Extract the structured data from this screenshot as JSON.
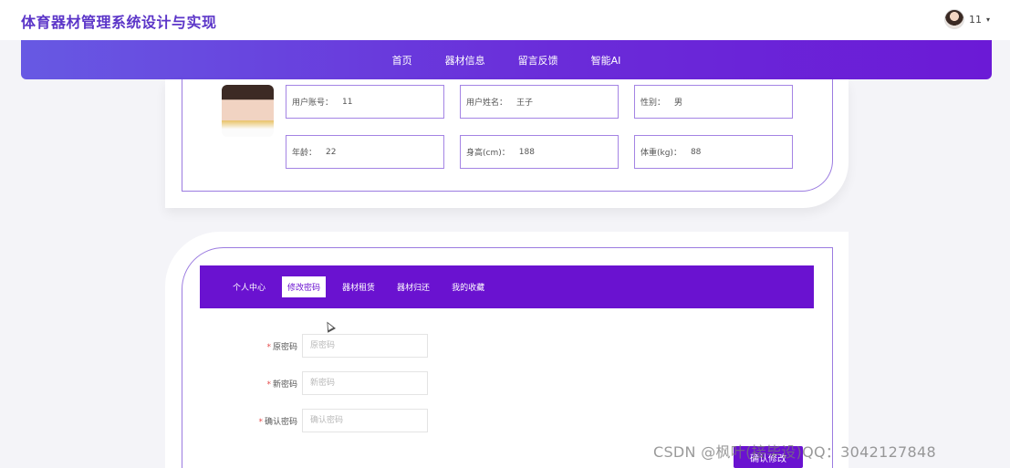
{
  "app": {
    "title": "体育器材管理系统设计与实现"
  },
  "user": {
    "name": "11",
    "caret": "▾"
  },
  "nav": {
    "items": [
      "首页",
      "器材信息",
      "留言反馈",
      "智能AI"
    ]
  },
  "profile": {
    "account_label": "用户账号：",
    "account_value": "11",
    "name_label": "用户姓名：",
    "name_value": "王子",
    "gender_label": "性别：",
    "gender_value": "男",
    "age_label": "年龄：",
    "age_value": "22",
    "height_label": "身高(cm)：",
    "height_value": "188",
    "weight_label": "体重(kg)：",
    "weight_value": "88"
  },
  "tabs": [
    "个人中心",
    "修改密码",
    "器材租赁",
    "器材归还",
    "我的收藏"
  ],
  "form": {
    "old_label": "原密码",
    "old_placeholder": "原密码",
    "new_label": "新密码",
    "new_placeholder": "新密码",
    "confirm_label": "确认密码",
    "confirm_placeholder": "确认密码",
    "submit_label": "确认修改"
  },
  "watermark": "CSDN @枫叶(接毕设)QQ：3042127848",
  "colors": {
    "brand": "#5b35c8",
    "accent": "#6a12d0",
    "border": "#9b7be0"
  }
}
